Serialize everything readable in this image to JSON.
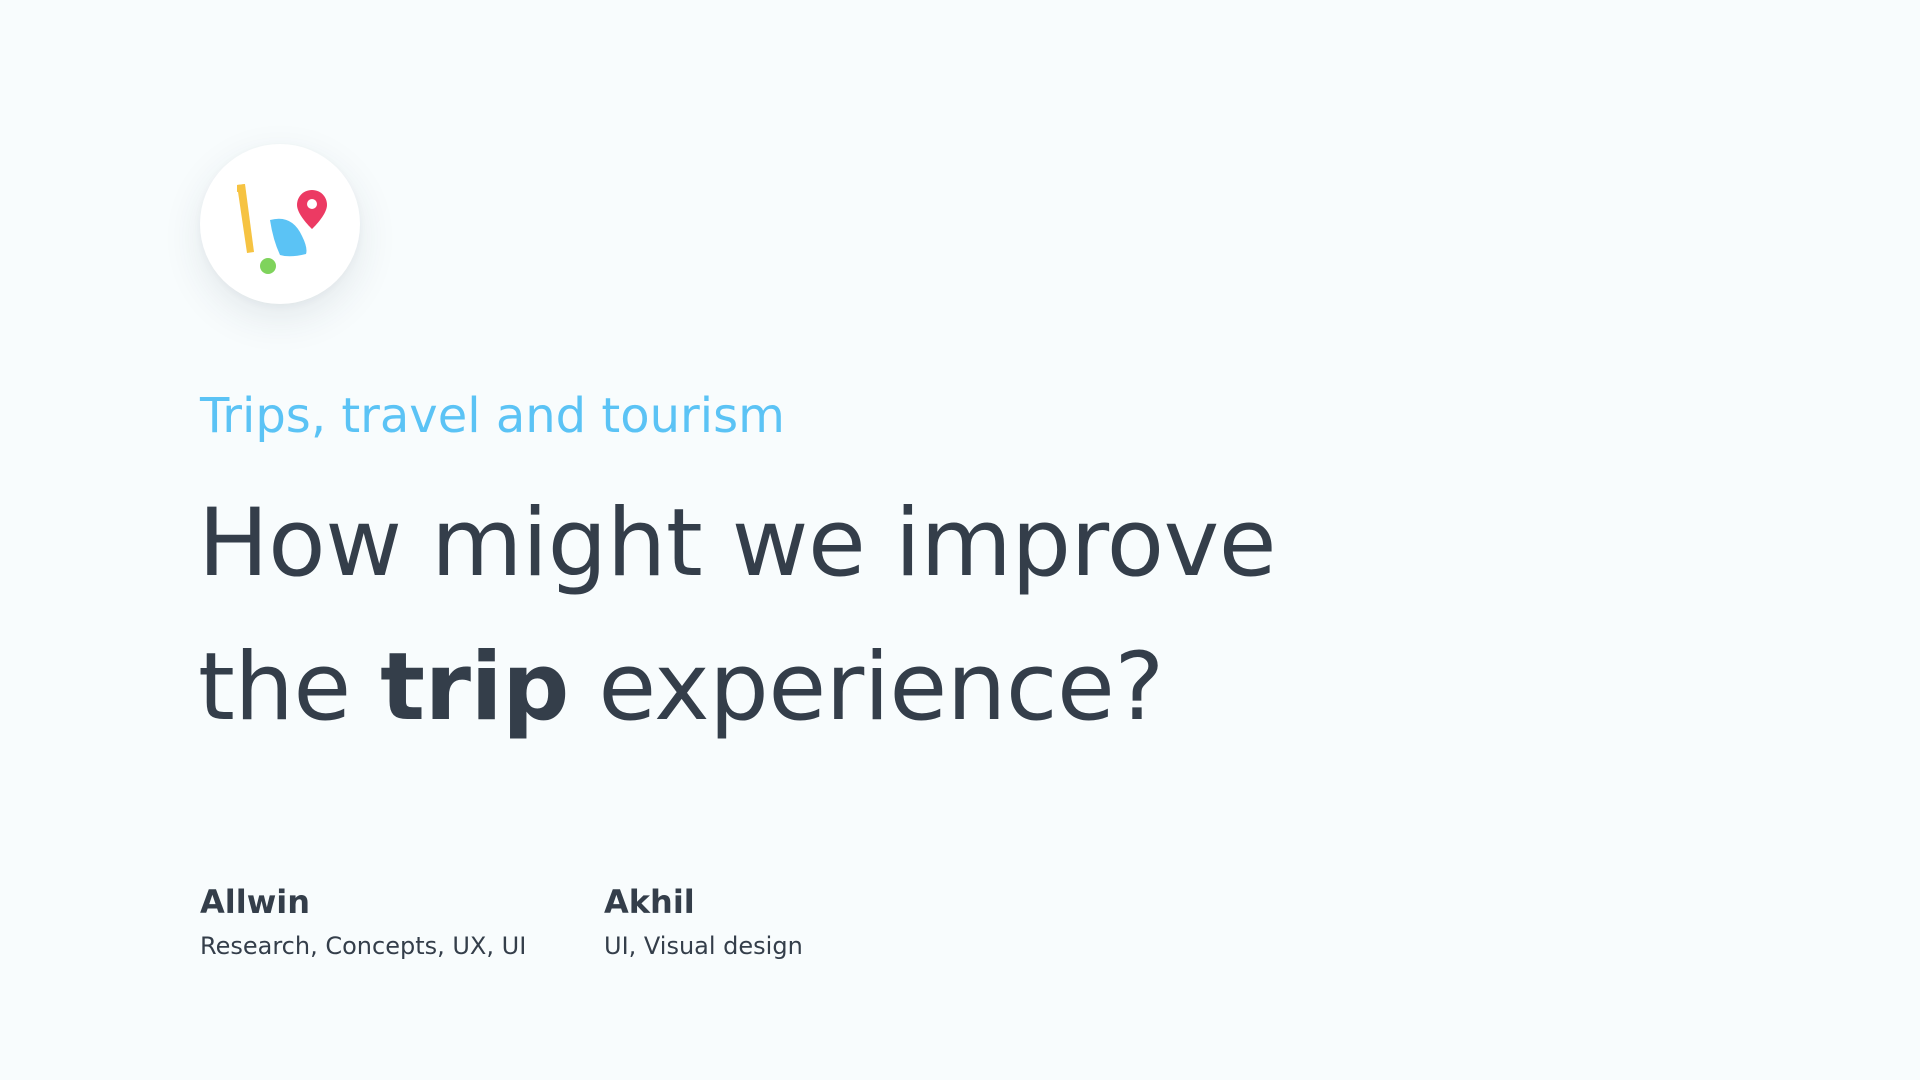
{
  "logo": {
    "icon": "travel-app-logo-icon",
    "colors": {
      "stick": "#f6c342",
      "ball": "#7fd35c",
      "shape": "#5bc3f5",
      "pin": "#ec3a63"
    }
  },
  "header": {
    "subtitle": "Trips, travel and tourism"
  },
  "headline": {
    "line1": "How might we improve",
    "line2_prefix": "the ",
    "line2_bold": "trip",
    "line2_suffix": " experience?"
  },
  "credits": [
    {
      "name": "Allwin",
      "role": "Research, Concepts, UX, UI"
    },
    {
      "name": "Akhil",
      "role": "UI, Visual design"
    }
  ],
  "colors": {
    "background": "#f8fcfd",
    "accent": "#5bc3f5",
    "text": "#343e4a"
  }
}
